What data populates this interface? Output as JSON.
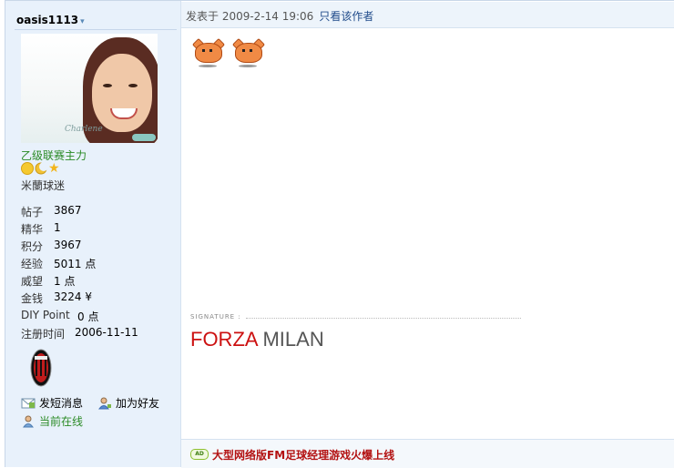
{
  "user": {
    "name": "oasis1113",
    "rank_title": "乙级联赛主力",
    "group": "米蘭球迷",
    "avatar_caption": "Charlene"
  },
  "stats": [
    {
      "label": "帖子",
      "value": "3867"
    },
    {
      "label": "精华",
      "value": "1"
    },
    {
      "label": "积分",
      "value": "3967"
    },
    {
      "label": "经验",
      "value": "5011 点"
    },
    {
      "label": "威望",
      "value": "1 点"
    },
    {
      "label": "金钱",
      "value": "3224 ¥"
    },
    {
      "label": "DIY Point",
      "value": "0 点"
    },
    {
      "label": "注册时间",
      "value": "2006-11-11"
    }
  ],
  "actions": {
    "send_message": "发短消息",
    "add_friend": "加为好友",
    "online_status": "当前在线"
  },
  "post": {
    "posted_at": "发表于 2009-2-14 19:06",
    "author_only": "只看该作者"
  },
  "signature": {
    "label": "SIGNATURE :",
    "text_red": "FORZA",
    "text_gray": "MILAN"
  },
  "ad": {
    "badge": "AD",
    "text": "大型网络版FM足球经理游戏火爆上线"
  },
  "colors": {
    "sidebar_bg": "#e8f1fb",
    "rank_green": "#2a8a25",
    "signature_red": "#cc1010",
    "ad_red": "#b31212"
  }
}
